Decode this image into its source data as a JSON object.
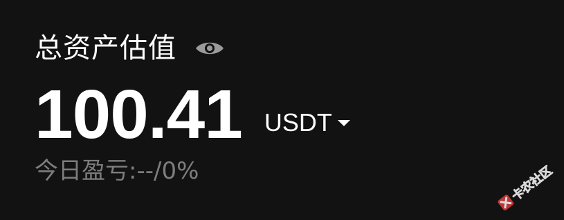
{
  "header": {
    "title": "总资产估值",
    "visibility_icon": "eye-icon"
  },
  "balance": {
    "amount": "100.41",
    "currency": "USDT",
    "currency_dropdown_icon": "caret-down-icon"
  },
  "pnl": {
    "label": "今日盈亏:--/0%"
  },
  "watermark": {
    "text": "卡农社区",
    "color": "#e03a3a"
  },
  "colors": {
    "background": "#121212",
    "primary_text": "#ffffff",
    "secondary_text": "#7d7d7d",
    "icon": "#9a9a9a"
  }
}
